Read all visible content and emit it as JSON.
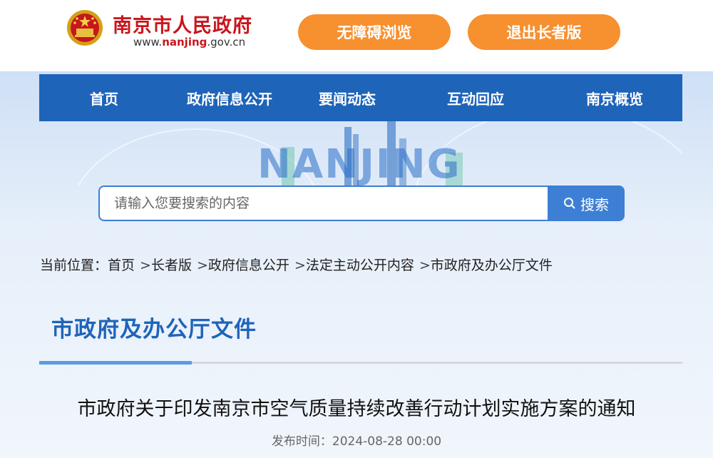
{
  "header": {
    "site_name": "南京市人民政府",
    "site_url_prefix": "www.",
    "site_url_brand": "nanjing",
    "site_url_suffix": ".gov.cn",
    "accessibility_label": "无障碍浏览",
    "exit_elder_label": "退出长者版",
    "accent_color": "#c8161d",
    "button_color": "#f7902f"
  },
  "nav": {
    "items": [
      {
        "label": "首页"
      },
      {
        "label": "政府信息公开"
      },
      {
        "label": "要闻动态"
      },
      {
        "label": "互动回应"
      },
      {
        "label": "南京概览"
      }
    ],
    "color": "#1e64b9"
  },
  "banner": {
    "word": "NANJING"
  },
  "search": {
    "placeholder": "请输入您要搜索的内容",
    "button_label": "搜索",
    "icon": "search-icon"
  },
  "breadcrumb": {
    "prefix": "当前位置：",
    "items": [
      "首页",
      "长者版",
      "政府信息公开",
      "法定主动公开内容",
      "市政府及办公厅文件"
    ],
    "separator": ">"
  },
  "section": {
    "title": "市政府及办公厅文件"
  },
  "article": {
    "title": "市政府关于印发南京市空气质量持续改善行动计划实施方案的通知",
    "publish_label": "发布时间：",
    "publish_time": "2024-08-28 00:00"
  }
}
